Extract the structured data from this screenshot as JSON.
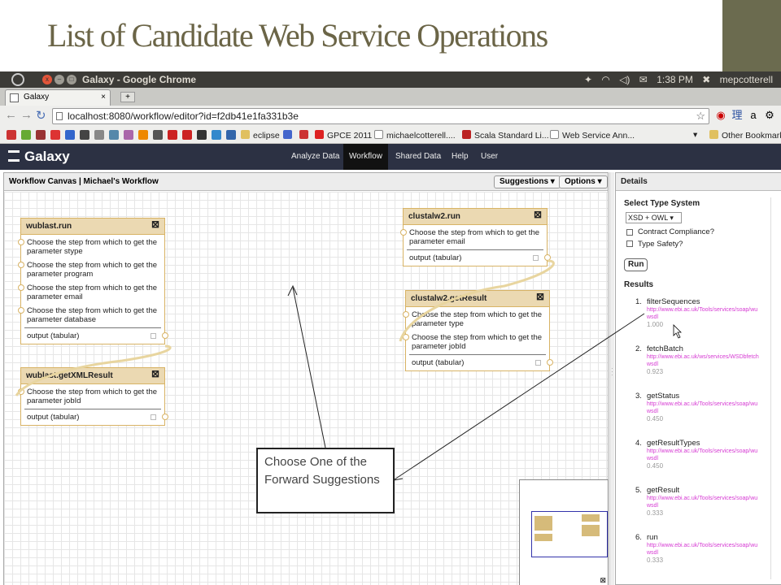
{
  "slide": {
    "title": "List of Candidate Web Service Operations"
  },
  "os_bar": {
    "window_title": "Galaxy - Google Chrome",
    "time": "1:38 PM",
    "user": "mepcotterell",
    "close": "x",
    "minimize": "–",
    "maximize": "□"
  },
  "browser": {
    "tab_title": "Galaxy",
    "tab_close": "×",
    "new_tab": "+",
    "url": "localhost:8080/workflow/editor?id=f2db41e1fa331b3e",
    "bookmarks": [
      "eclipse",
      "GPCE 2011",
      "michaelcotterell....",
      "Scala Standard Li...",
      "Web Service Ann..."
    ],
    "other_bookmarks": "Other Bookmarks"
  },
  "galaxy": {
    "brand": "Galaxy",
    "nav": [
      "Analyze Data",
      "Workflow",
      "Shared Data",
      "Help",
      "User"
    ]
  },
  "canvas": {
    "header": "Workflow Canvas | Michael's Workflow",
    "suggestions_label": "Suggestions",
    "options_label": "Options",
    "nodes": {
      "wublast_run": {
        "title": "wublast.run",
        "inputs": [
          "Choose the step from which to get the parameter stype",
          "Choose the step from which to get the parameter program",
          "Choose the step from which to get the parameter email",
          "Choose the step from which to get the parameter database"
        ],
        "output": "output (tabular)"
      },
      "wublast_getxml": {
        "title": "wublast.getXMLResult",
        "inputs": [
          "Choose the step from which to get the parameter jobId"
        ],
        "output": "output (tabular)"
      },
      "clustalw2_run": {
        "title": "clustalw2.run",
        "inputs": [
          "Choose the step from which to get the parameter email"
        ],
        "output": "output (tabular)"
      },
      "clustalw2_getresult": {
        "title": "clustalw2.getResult",
        "inputs": [
          "Choose the step from which to get the parameter type",
          "Choose the step from which to get the parameter jobId"
        ],
        "output": "output (tabular)"
      }
    }
  },
  "details": {
    "header": "Details",
    "type_system_label": "Select Type System",
    "type_system_value": "XSD + OWL ▾",
    "contract_label": "Contract Compliance?",
    "type_safety_label": "Type Safety?",
    "run_label": "Run",
    "results_label": "Results",
    "results": [
      {
        "num": "1.",
        "name": "filterSequences",
        "url": "http://www.ebi.ac.uk/Tools/services/soap/wu",
        "url2": "wsdl",
        "score": "1.000"
      },
      {
        "num": "2.",
        "name": "fetchBatch",
        "url": "http://www.ebi.ac.uk/ws/services/WSDbfetch",
        "url2": "wsdl",
        "score": "0.923"
      },
      {
        "num": "3.",
        "name": "getStatus",
        "url": "http://www.ebi.ac.uk/Tools/services/soap/wu",
        "url2": "wsdl",
        "score": "0.450"
      },
      {
        "num": "4.",
        "name": "getResultTypes",
        "url": "http://www.ebi.ac.uk/Tools/services/soap/wu",
        "url2": "wsdl",
        "score": "0.450"
      },
      {
        "num": "5.",
        "name": "getResult",
        "url": "http://www.ebi.ac.uk/Tools/services/soap/wu",
        "url2": "wsdl",
        "score": "0.333"
      },
      {
        "num": "6.",
        "name": "run",
        "url": "http://www.ebi.ac.uk/Tools/services/soap/wu",
        "url2": "wsdl",
        "score": "0.333"
      }
    ]
  },
  "callout": {
    "text": "Choose One of the Forward Suggestions"
  },
  "colors": {
    "title": "#6b6547",
    "node_header": "#ebd9b2",
    "node_border": "#d8b365",
    "masthead": "#2c3143",
    "result_url": "#d63ad3"
  }
}
